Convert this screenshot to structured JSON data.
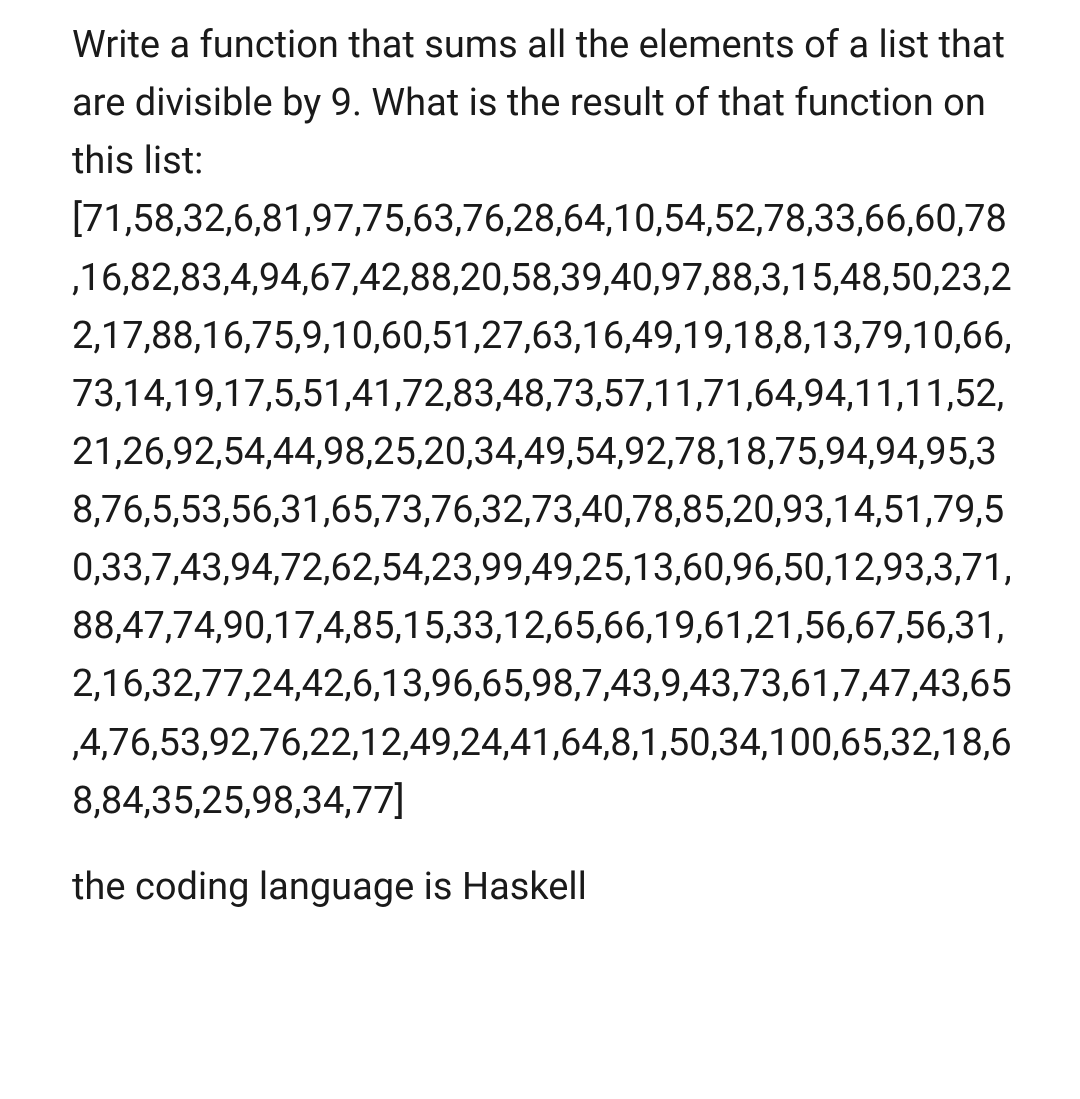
{
  "question": {
    "prompt": "Write a function that sums all the elements of a list that are divisible by 9. What is the result of that function on this list: [71,58,32,6,81,97,75,63,76,28,64,10,54,52,78,33,66,60,78,16,82,83,4,94,67,42,88,20,58,39,40,97,88,3,15,48,50,23,22,17,88,16,75,9,10,60,51,27,63,16,49,19,18,8,13,79,10,66,73,14,19,17,5,51,41,72,83,48,73,57,11,71,64,94,11,11,52,21,26,92,54,44,98,25,20,34,49,54,92,78,18,75,94,94,95,38,76,5,53,56,31,65,73,76,32,73,40,78,85,20,93,14,51,79,50,33,7,43,94,72,62,54,23,99,49,25,13,60,96,50,12,93,3,71,88,47,74,90,17,4,85,15,33,12,65,66,19,61,21,56,67,56,31,2,16,32,77,24,42,6,13,96,65,98,7,43,9,43,73,61,7,47,43,65,4,76,53,92,76,22,12,49,24,41,64,8,1,50,34,100,65,32,18,68,84,35,25,98,34,77]",
    "language_note": "the coding language is Haskell"
  }
}
